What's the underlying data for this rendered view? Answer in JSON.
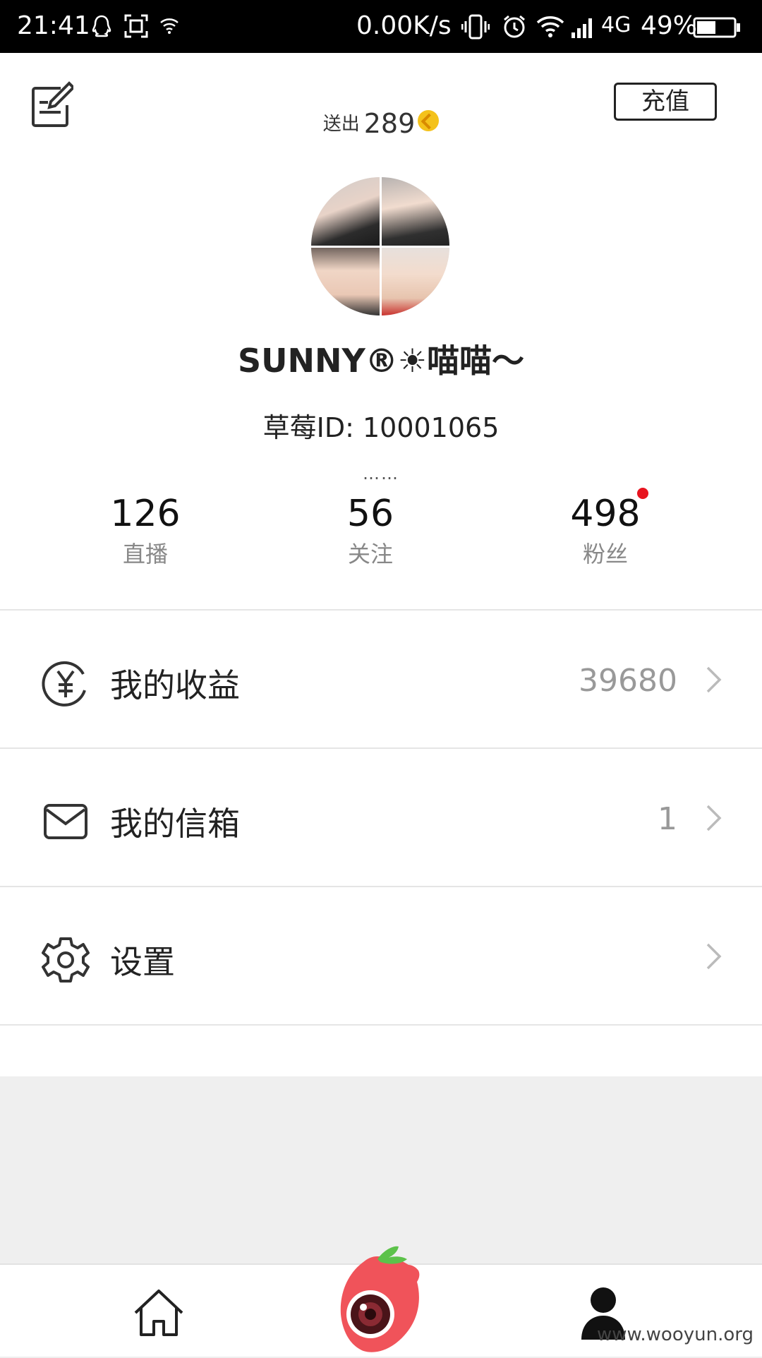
{
  "status_bar": {
    "time": "21:41",
    "network_speed": "0.00K/s",
    "signal_label": "4G",
    "battery_percent": "49%"
  },
  "header": {
    "recharge_label": "充值",
    "sent_label": "送出",
    "sent_count": "289"
  },
  "profile": {
    "username": "SUNNY®☀喵喵～",
    "user_id": "草莓ID: 10001065",
    "bio": "……"
  },
  "stats": [
    {
      "value": "126",
      "label": "直播"
    },
    {
      "value": "56",
      "label": "关注"
    },
    {
      "value": "498",
      "label": "粉丝"
    }
  ],
  "menu": [
    {
      "label": "我的收益",
      "value": "39680"
    },
    {
      "label": "我的信箱",
      "value": "1"
    },
    {
      "label": "设置",
      "value": ""
    }
  ],
  "watermark": "www.wooyun.org",
  "colors": {
    "notification_dot": "#e8141f",
    "coin": "#f4c21b",
    "logo_red": "#f0535a",
    "logo_green": "#5cc24a"
  }
}
